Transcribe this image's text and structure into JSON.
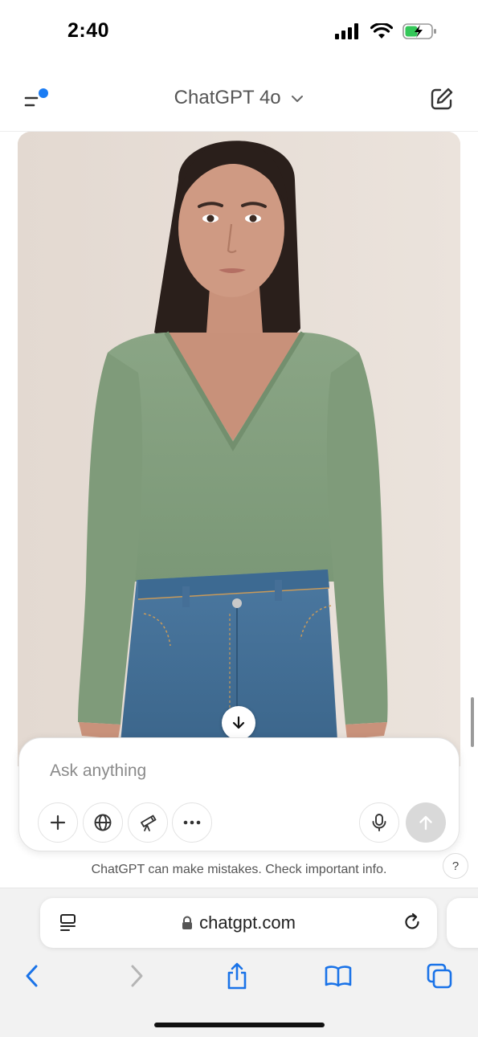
{
  "status": {
    "time": "2:40"
  },
  "header": {
    "model": "ChatGPT 4o"
  },
  "composer": {
    "placeholder": "Ask anything"
  },
  "disclaimer": "ChatGPT can make mistakes. Check important info.",
  "help_label": "?",
  "browser": {
    "url": "chatgpt.com"
  },
  "icons": {
    "menu": "menu-icon",
    "compose": "new-chat-icon",
    "plus": "plus-icon",
    "globe": "globe-icon",
    "telescope": "telescope-icon",
    "more": "more-icon",
    "mic": "mic-icon",
    "send": "arrow-up-icon",
    "scroll_down": "arrow-down-icon"
  },
  "colors": {
    "accent_dot": "#1b7cf3",
    "ios_blue": "#1a73e8",
    "shirt": "#839f7f",
    "denim": "#3f6c94",
    "background": "#e6ddd6"
  }
}
